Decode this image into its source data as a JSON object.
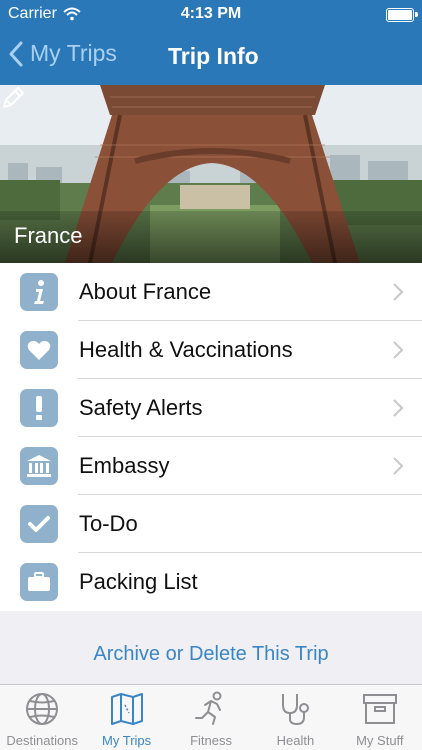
{
  "status_bar": {
    "carrier": "Carrier",
    "time": "4:13 PM"
  },
  "nav": {
    "back_label": "My Trips",
    "title": "Trip Info"
  },
  "hero": {
    "country": "France"
  },
  "menu": [
    {
      "label": "About France",
      "icon": "info-icon",
      "chevron": true
    },
    {
      "label": "Health & Vaccinations",
      "icon": "heart-icon",
      "chevron": true
    },
    {
      "label": "Safety Alerts",
      "icon": "exclamation-icon",
      "chevron": true
    },
    {
      "label": "Embassy",
      "icon": "building-icon",
      "chevron": true
    },
    {
      "label": "To-Do",
      "icon": "checkmark-icon",
      "chevron": false
    },
    {
      "label": "Packing List",
      "icon": "briefcase-icon",
      "chevron": false
    }
  ],
  "archive_label": "Archive or Delete This Trip",
  "tabs": [
    {
      "label": "Destinations",
      "icon": "globe-icon",
      "active": false
    },
    {
      "label": "My Trips",
      "icon": "map-icon",
      "active": true
    },
    {
      "label": "Fitness",
      "icon": "runner-icon",
      "active": false
    },
    {
      "label": "Health",
      "icon": "stethoscope-icon",
      "active": false
    },
    {
      "label": "My Stuff",
      "icon": "box-icon",
      "active": false
    }
  ],
  "colors": {
    "nav": "#2a78b8",
    "accent": "#3a86c4",
    "icon_tile": "#8fb1cc",
    "tab_inactive": "#8e8e93"
  }
}
